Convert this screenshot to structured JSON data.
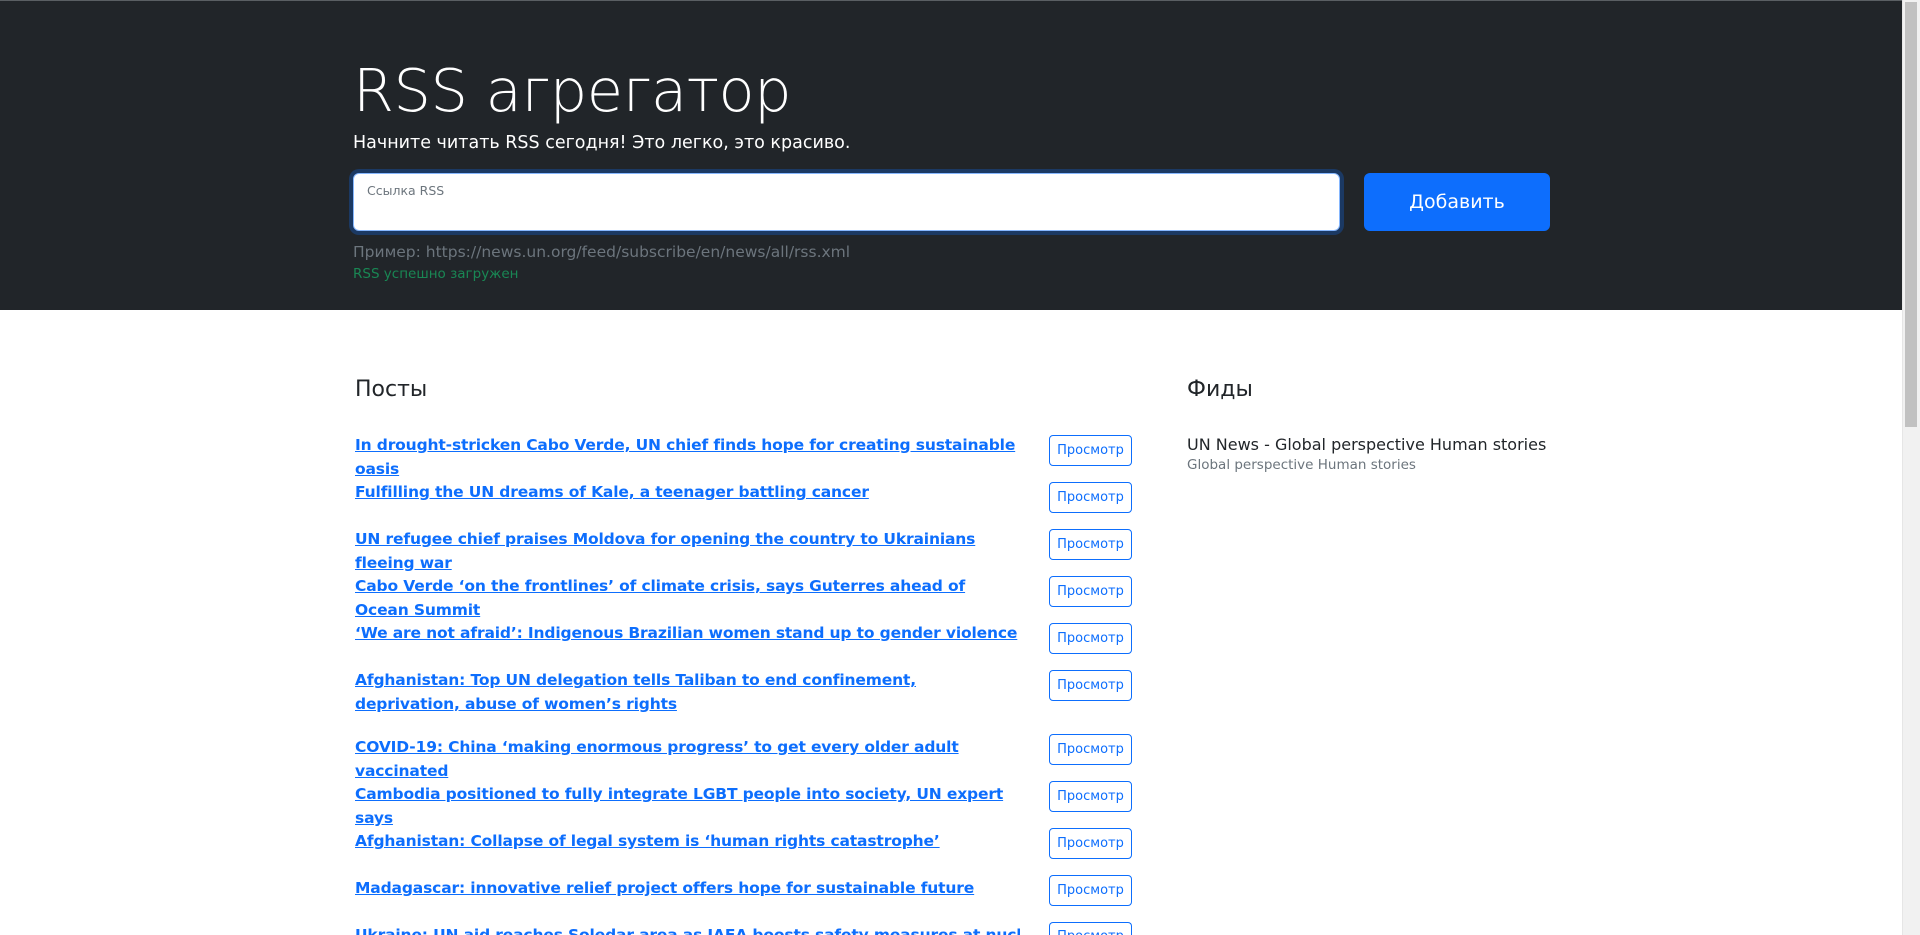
{
  "header": {
    "title": "RSS агрегатор",
    "lead": "Начните читать RSS сегодня! Это легко, это красиво.",
    "input_label": "Ссылка RSS",
    "input_value": "",
    "add_button_label": "Добавить",
    "example": "Пример: https://news.un.org/feed/subscribe/en/news/all/rss.xml",
    "feedback": "RSS успешно загружен"
  },
  "posts": {
    "title": "Посты",
    "view_label": "Просмотр",
    "items": [
      {
        "title": "In drought-stricken Cabo Verde, UN chief finds hope for creating sustainable oasis"
      },
      {
        "title": "Fulfilling the UN dreams of Kale, a teenager battling cancer"
      },
      {
        "title": "UN refugee chief praises Moldova for opening the country to Ukrainians fleeing war"
      },
      {
        "title": "Cabo Verde ‘on the frontlines’ of climate crisis, says Guterres ahead of Ocean Summit"
      },
      {
        "title": "‘We are not afraid’: Indigenous Brazilian women stand up to gender violence"
      },
      {
        "title": "Afghanistan: Top UN delegation tells Taliban to end confinement, deprivation, abuse of women’s rights"
      },
      {
        "title": "COVID-19: China ‘making enormous progress’ to get every older adult vaccinated"
      },
      {
        "title": "Cambodia positioned to fully integrate LGBT people into society, UN expert says"
      },
      {
        "title": "Afghanistan: Collapse of legal system is ‘human rights catastrophe’"
      },
      {
        "title": "Madagascar: innovative relief project offers hope for sustainable future"
      },
      {
        "title": "Ukraine: UN aid reaches Soledar area as IAEA boosts safety measures at nuclear sites"
      }
    ]
  },
  "feeds": {
    "title": "Фиды",
    "items": [
      {
        "title": "UN News - Global perspective Human stories",
        "description": "Global perspective Human stories"
      }
    ]
  },
  "colors": {
    "hero_bg": "#212529",
    "accent": "#0d6efd",
    "success": "#198754",
    "muted": "#6c757d"
  }
}
